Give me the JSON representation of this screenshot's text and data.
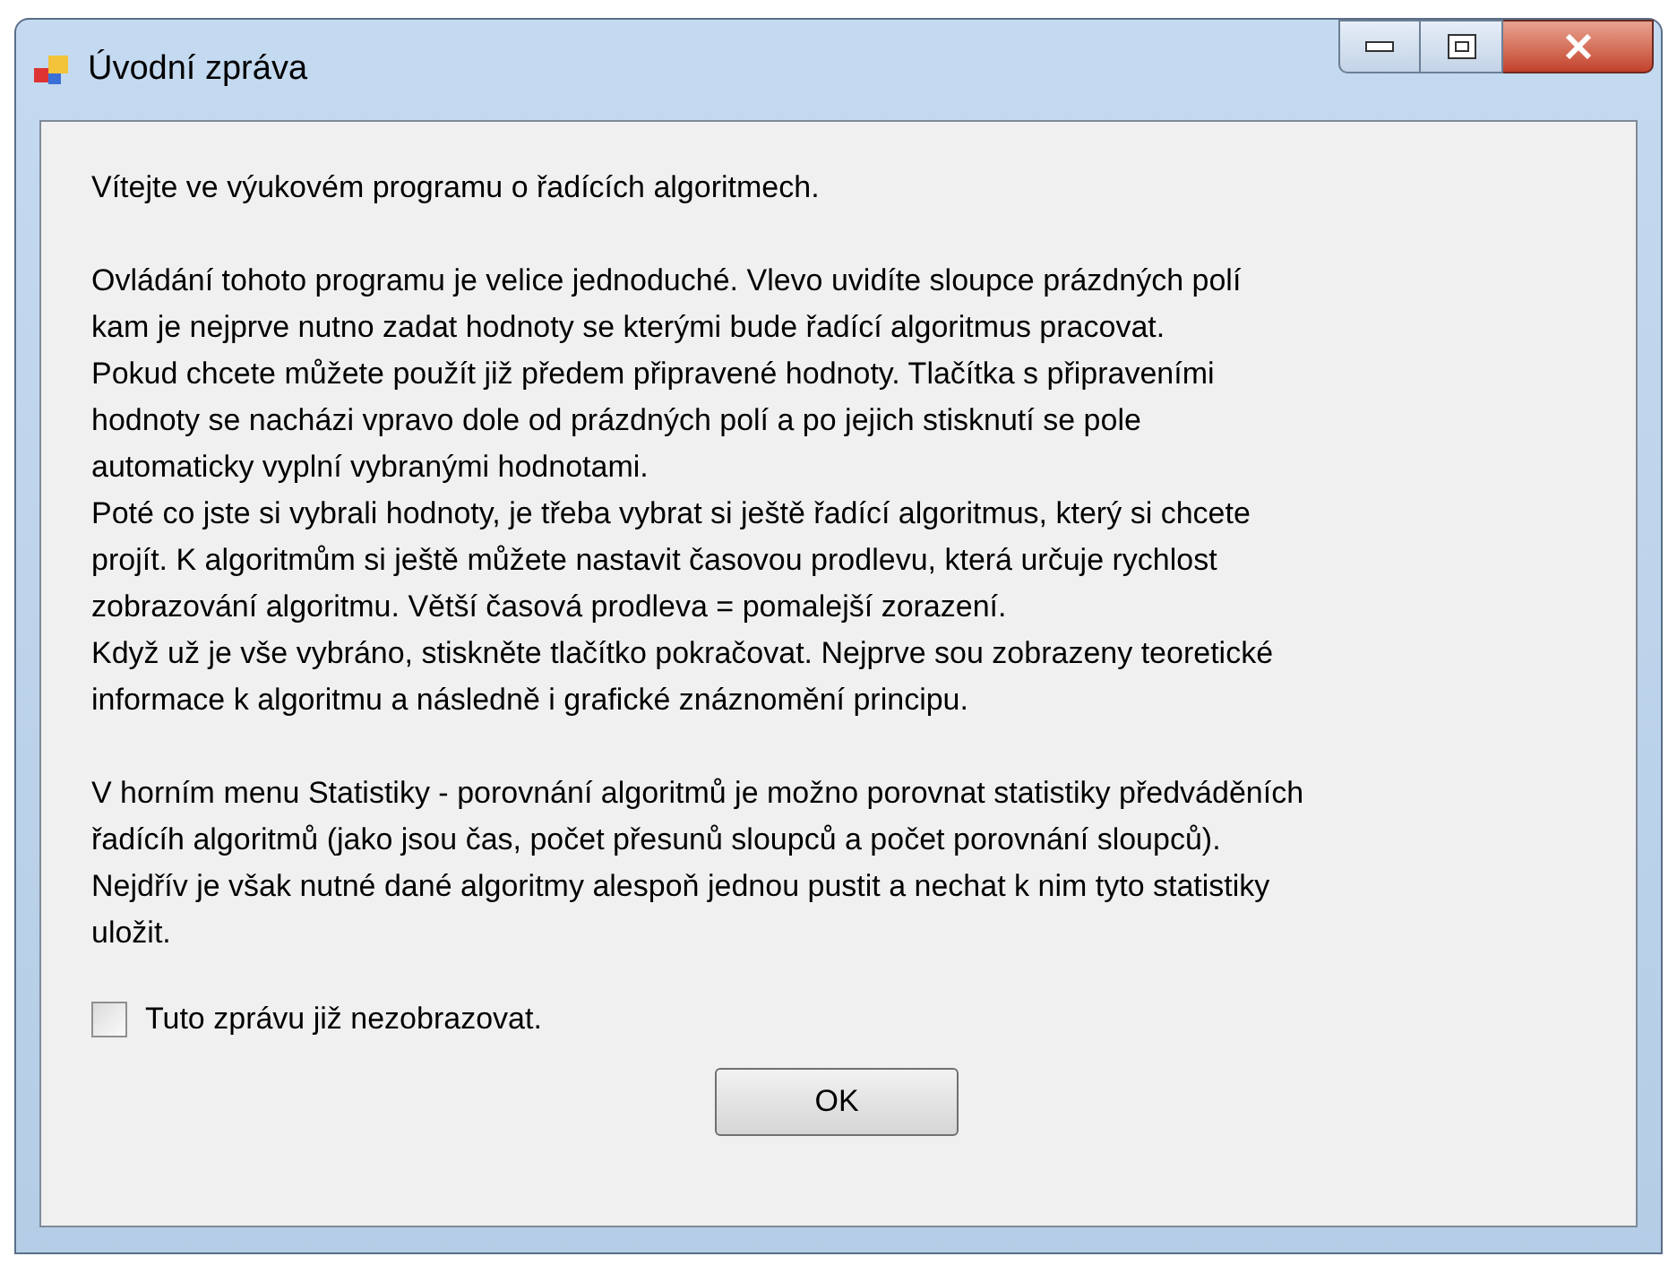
{
  "window": {
    "title": "Úvodní zpráva"
  },
  "paragraphs": [
    [
      "Vítejte ve výukovém programu o řadících algoritmech."
    ],
    [
      "Ovládání tohoto programu je velice jednoduché. Vlevo uvidíte sloupce prázdných polí",
      "kam je nejprve nutno zadat hodnoty se kterými bude řadící algoritmus pracovat.",
      "Pokud chcete můžete použít již předem připravené hodnoty. Tlačítka s připraveními",
      "hodnoty se nacházi vpravo dole od prázdných polí a po jejich stisknutí se pole",
      "automaticky vyplní vybranými hodnotami.",
      "Poté co jste si vybrali hodnoty, je třeba vybrat si ještě řadící algoritmus, který si chcete",
      "projít. K algoritmům si ještě můžete nastavit časovou prodlevu, která určuje rychlost",
      "zobrazování algoritmu. Větší časová prodleva = pomalejší zorazení.",
      "Když už je vše vybráno, stiskněte tlačítko pokračovat. Nejprve sou zobrazeny teoretické",
      "informace k algoritmu a následně i grafické znáznomění principu."
    ],
    [
      "V horním menu Statistiky - porovnání algoritmů je možno porovnat statistiky předváděních",
      "řadícíh algoritmů (jako jsou čas, počet přesunů sloupců a počet porovnání sloupců).",
      "Nejdřív je však nutné dané algoritmy alespoň jednou pustit a nechat k nim tyto statistiky",
      "uložit."
    ]
  ],
  "checkbox": {
    "label": "Tuto zprávu již nezobrazovat.",
    "checked": false
  },
  "button": "OK"
}
